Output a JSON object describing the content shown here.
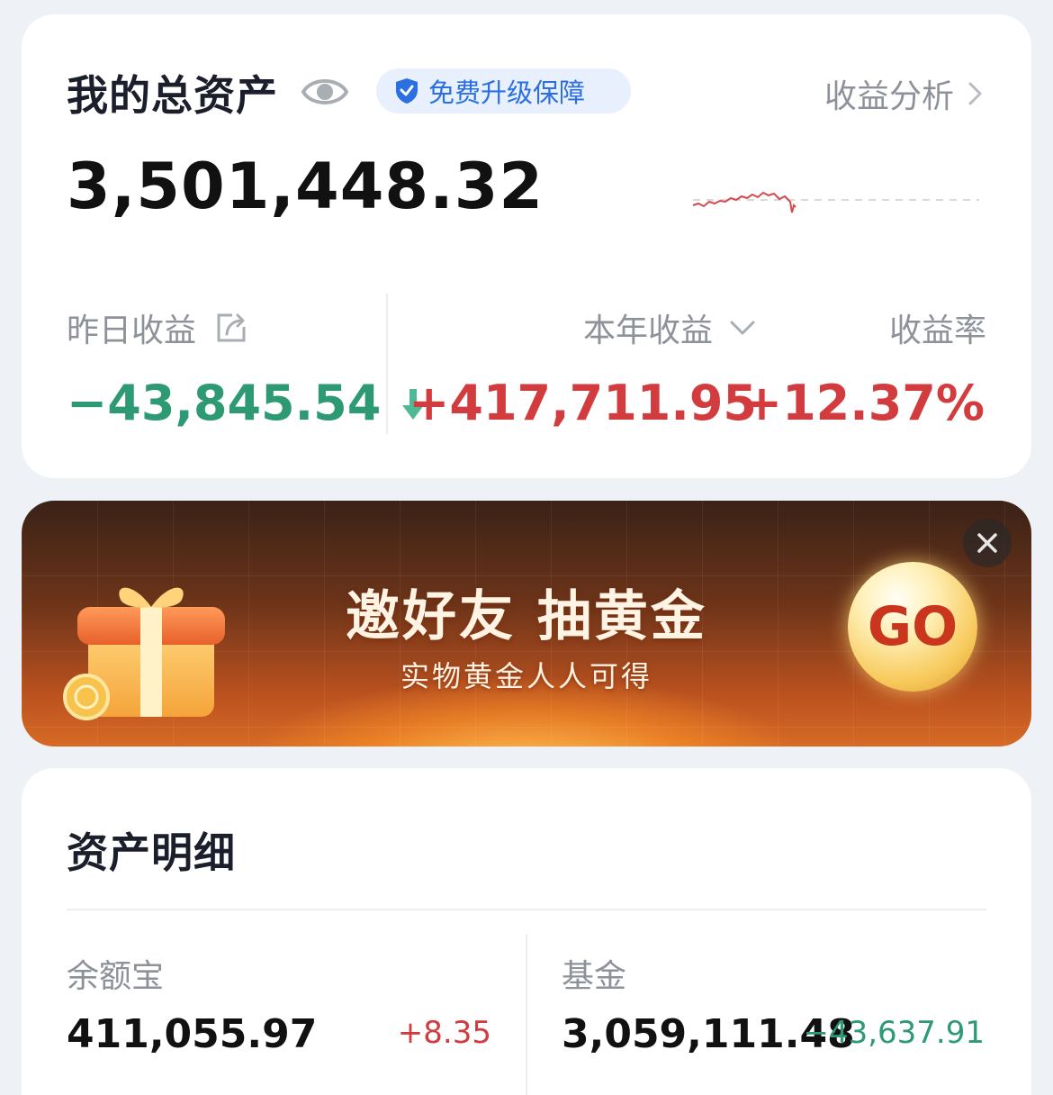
{
  "total": {
    "title": "我的总资产",
    "badge_label": "免费升级保障",
    "analysis_label": "收益分析",
    "amount": "3,501,448.32",
    "yesterday_label": "昨日收益",
    "yesterday_value": "−43,845.54",
    "year_label": "本年收益",
    "year_value": "+417,711.95",
    "rate_label": "收益率",
    "rate_value": "+12.37%"
  },
  "banner": {
    "title": "邀好友 抽黄金",
    "subtitle": "实物黄金人人可得",
    "go_label": "GO"
  },
  "details": {
    "title": "资产明细",
    "items": [
      {
        "name": "余额宝",
        "amount": "411,055.97",
        "change": "+8.35",
        "direction": "up"
      },
      {
        "name": "基金",
        "amount": "3,059,111.48",
        "change": "−43,637.91",
        "direction": "down"
      }
    ]
  },
  "colors": {
    "gain": "#d23c3f",
    "loss": "#2e9a73",
    "accent": "#2b6fe0",
    "muted": "#8d9199"
  },
  "icons": {
    "eye": "eye-icon",
    "shield": "shield-check-icon",
    "chevron": "chevron-right-icon",
    "share": "share-icon",
    "down_arrow": "down-arrow-icon",
    "dropdown": "chevron-down-icon",
    "close": "close-icon",
    "gift": "gift-box-icon"
  }
}
